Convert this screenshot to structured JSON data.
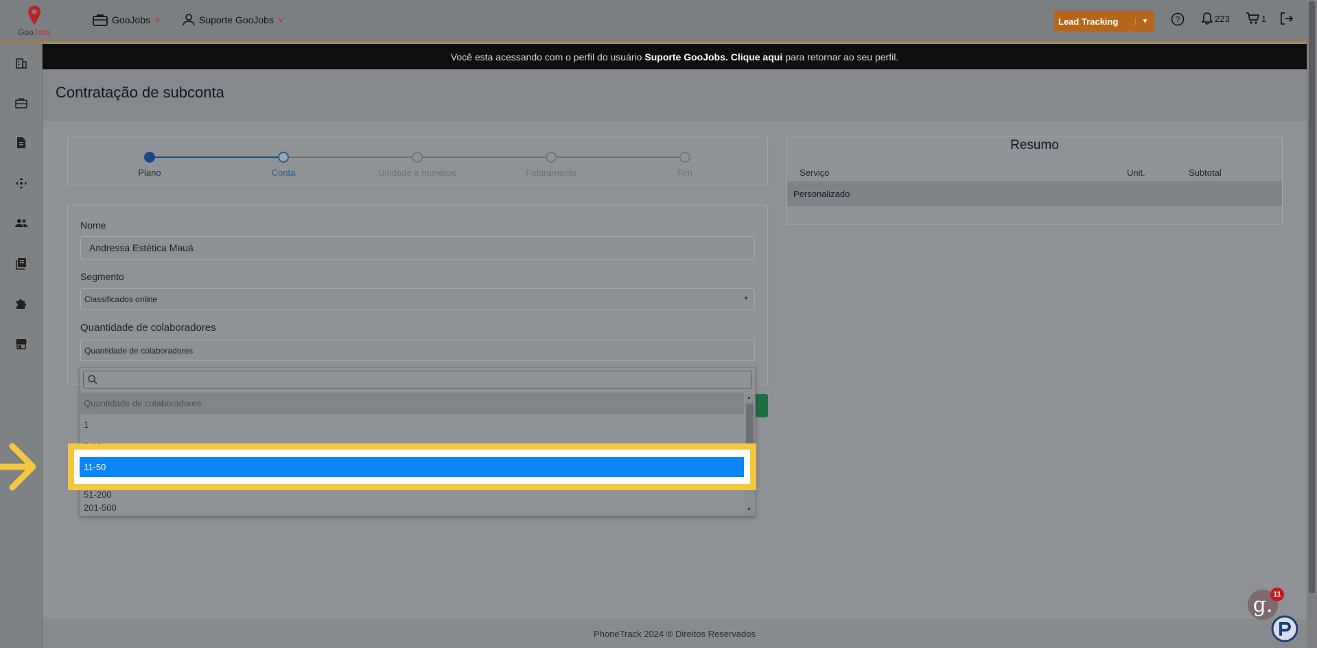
{
  "header": {
    "logo_text_1": "Goo",
    "logo_text_2": "Jobs",
    "nav_company": "GooJobs",
    "nav_user": "Suporte GooJobs",
    "lead_button": "Lead Tracking",
    "notifications_count": "223",
    "cart_count": "1"
  },
  "notice": {
    "prefix": "Você esta acessando com o perfil do usuário",
    "user": "Suporte GooJobs.",
    "link": "Clique aqui",
    "suffix": "para retornar ao seu perfil."
  },
  "page": {
    "title": "Contratação de subconta"
  },
  "stepper": {
    "steps": [
      "Plano",
      "Conta",
      "Unidade e números",
      "Faturamento",
      "Fim"
    ],
    "current_step": 2
  },
  "form": {
    "name_label": "Nome",
    "name_value": "Andressa Estética Mauá",
    "segment_label": "Segmento",
    "segment_value": "Classificados online",
    "qty_label": "Quantidade de colaboradores",
    "qty_placeholder": "Quantidade de colaboradores"
  },
  "dropdown": {
    "options": [
      "Quantidade de colaboradores",
      "1",
      "2-10",
      "11-50",
      "51-200",
      "201-500"
    ],
    "selected": "11-50"
  },
  "summary": {
    "title": "Resumo",
    "col_service": "Serviço",
    "col_unit": "Unit.",
    "col_subtotal": "Subtotal",
    "row_label": "Personalizado"
  },
  "footer": {
    "text": "PhoneTrack 2024 ® Direitos Reservados"
  },
  "chat": {
    "badge": "11",
    "letter": "g."
  },
  "colors": {
    "highlight": "#f4c73e",
    "selected_option": "#0b86f7",
    "lead_button": "#b5661a",
    "step_active": "#154a86"
  }
}
